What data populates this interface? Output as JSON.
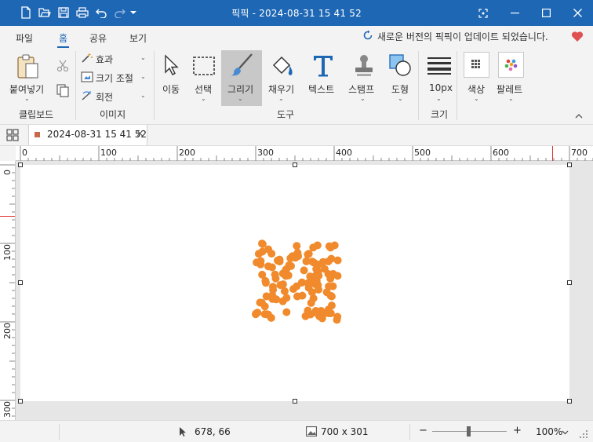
{
  "window": {
    "title": "픽픽 - 2024-08-31 15 41 52"
  },
  "menu": {
    "tabs": [
      {
        "label": "파일"
      },
      {
        "label": "홈"
      },
      {
        "label": "공유"
      },
      {
        "label": "보기"
      }
    ],
    "active_tab": "홈",
    "update_notice": "새로운 버전의 픽픽이 업데이트 되었습니다."
  },
  "ribbon": {
    "clipboard": {
      "paste_label": "붙여넣기",
      "group_label": "클립보드"
    },
    "image": {
      "effects_label": "효과",
      "resize_label": "크기 조절",
      "rotate_label": "회전",
      "group_label": "이미지"
    },
    "tools": {
      "items": [
        {
          "label": "이동",
          "icon": "pointer-icon"
        },
        {
          "label": "선택",
          "icon": "marquee-select-icon"
        },
        {
          "label": "그리기",
          "icon": "brush-icon",
          "selected": true
        },
        {
          "label": "채우기",
          "icon": "fill-bucket-icon"
        },
        {
          "label": "텍스트",
          "icon": "text-icon"
        },
        {
          "label": "스탬프",
          "icon": "stamp-icon"
        },
        {
          "label": "도형",
          "icon": "shape-icon"
        }
      ],
      "group_label": "도구"
    },
    "size": {
      "value_label": "10px",
      "group_label": "크기"
    },
    "color_label": "색상",
    "palette_label": "팔레트"
  },
  "document_tab": {
    "title": "2024-08-31 15 41 52",
    "close": "×"
  },
  "rulers": {
    "horizontal_ticks": [
      "0",
      "100",
      "200",
      "300",
      "400",
      "500",
      "600",
      "700"
    ],
    "vertical_ticks": [
      "0",
      "100",
      "200",
      "300"
    ]
  },
  "status": {
    "cursor_position": "678, 66",
    "image_size": "700 x 301",
    "zoom": "100%",
    "zoom_out": "−",
    "zoom_in": "+"
  },
  "colors": {
    "titlebar": "#1e67b5",
    "accent": "#1e67b5",
    "dots": "#f08a2c",
    "ruler_marker": "#e03030",
    "heart": "#e05050"
  }
}
